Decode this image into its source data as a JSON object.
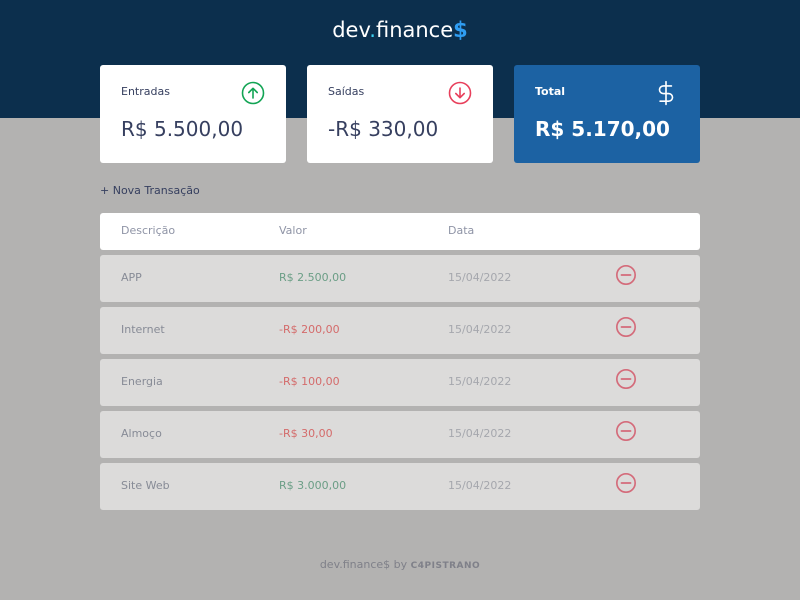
{
  "header": {
    "logo_left": "dev",
    "logo_dot": ".",
    "logo_right": "finance",
    "logo_symbol": "$"
  },
  "cards": {
    "income": {
      "label": "Entradas",
      "value": "R$ 5.500,00",
      "icon": "arrow-up-circle-icon"
    },
    "expense": {
      "label": "Saídas",
      "value": "-R$ 330,00",
      "icon": "arrow-down-circle-icon"
    },
    "total": {
      "label": "Total",
      "value": "R$ 5.170,00",
      "icon": "dollar-sign-icon"
    }
  },
  "new_transaction": {
    "label": "+ Nova Transação"
  },
  "table": {
    "headers": [
      "Descrição",
      "Valor",
      "Data"
    ],
    "rows": [
      {
        "description": "APP",
        "amount": "R$ 2.500,00",
        "type": "income",
        "date": "15/04/2022"
      },
      {
        "description": "Internet",
        "amount": "-R$ 200,00",
        "type": "expense",
        "date": "15/04/2022"
      },
      {
        "description": "Energia",
        "amount": "-R$ 100,00",
        "type": "expense",
        "date": "15/04/2022"
      },
      {
        "description": "Almoço",
        "amount": "-R$ 30,00",
        "type": "expense",
        "date": "15/04/2022"
      },
      {
        "description": "Site Web",
        "amount": "R$ 3.000,00",
        "type": "income",
        "date": "15/04/2022"
      }
    ]
  },
  "footer": {
    "text": "dev.finance$ by",
    "brand": "C4PISTRANO"
  },
  "colors": {
    "header_bg": "#0c2f4d",
    "page_bg": "#b3b2b1",
    "total_card_bg": "#1c62a3",
    "income_green": "#12a454",
    "expense_red": "#e83f5b"
  }
}
